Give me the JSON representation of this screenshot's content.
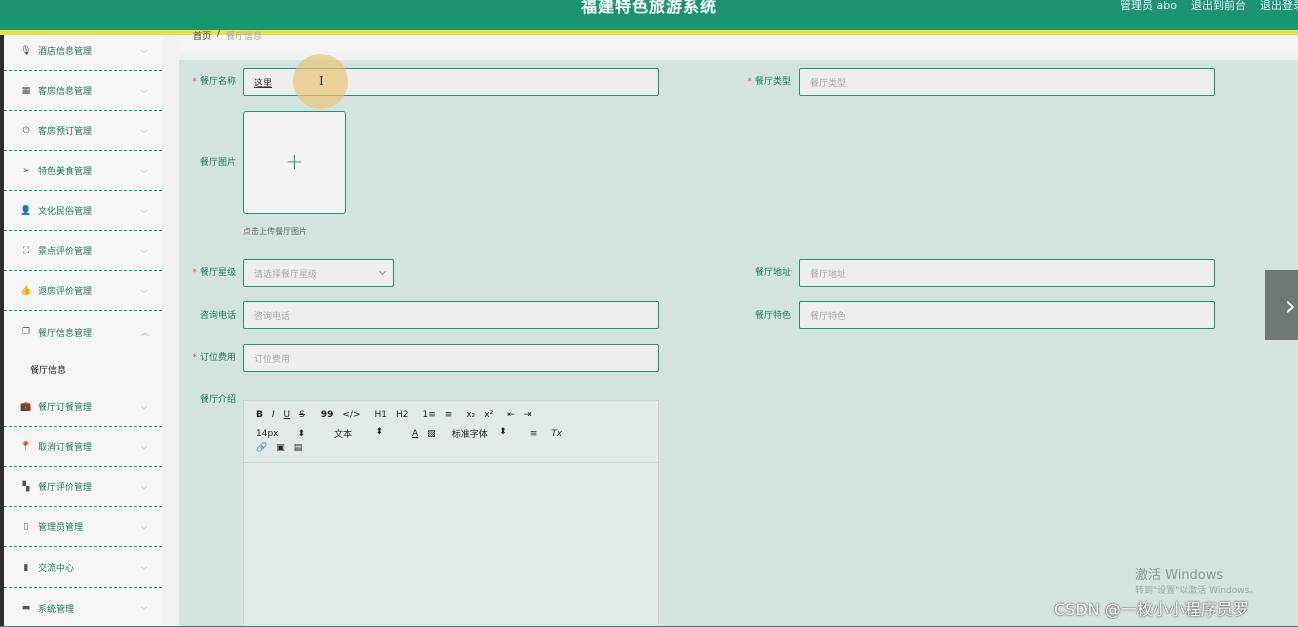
{
  "header": {
    "title": "福建特色旅游系统",
    "links": [
      "管理员 abo",
      "退出到前台",
      "退出登录"
    ]
  },
  "colors": {
    "primary": "#1b9472",
    "stripe": "#e4e24a",
    "content_bg": "#d3e3e0",
    "required": "#e55"
  },
  "breadcrumb": {
    "home": "首页",
    "sep": "/",
    "current": "餐厅信息"
  },
  "sidebar": {
    "items": [
      {
        "label": "酒店信息管理",
        "icon": "mic-icon"
      },
      {
        "label": "客房信息管理",
        "icon": "grid-icon"
      },
      {
        "label": "客房预订管理",
        "icon": "power-icon"
      },
      {
        "label": "特色美食管理",
        "icon": "send-icon"
      },
      {
        "label": "文化民俗管理",
        "icon": "user-icon"
      },
      {
        "label": "景点评价管理",
        "icon": "fullscreen-icon"
      },
      {
        "label": "退房评价管理",
        "icon": "thumbs-up-icon"
      },
      {
        "label": "餐厅信息管理",
        "icon": "copy-icon"
      },
      {
        "label": "餐厅订餐管理",
        "icon": "briefcase-icon"
      },
      {
        "label": "取消订餐管理",
        "icon": "location-icon"
      },
      {
        "label": "餐厅评价管理",
        "icon": "apps-icon"
      },
      {
        "label": "管理员管理",
        "icon": "phone-icon"
      },
      {
        "label": "交流中心",
        "icon": "chart-icon"
      },
      {
        "label": "系统管理",
        "icon": "ticket-icon"
      }
    ],
    "sub_item": "餐厅信息"
  },
  "form": {
    "name": {
      "label": "餐厅名称",
      "value": "这里"
    },
    "type": {
      "label": "餐厅类型",
      "placeholder": "餐厅类型"
    },
    "image": {
      "label": "餐厅图片",
      "plus": "+",
      "hint": "点击上传餐厅图片"
    },
    "rating": {
      "label": "餐厅星级",
      "placeholder": "请选择餐厅星级"
    },
    "address": {
      "label": "餐厅地址",
      "placeholder": "餐厅地址"
    },
    "phone": {
      "label": "咨询电话",
      "placeholder": "咨询电话"
    },
    "feature": {
      "label": "餐厅特色",
      "placeholder": "餐厅特色"
    },
    "fee": {
      "label": "订位费用",
      "placeholder": "订位费用"
    },
    "intro": {
      "label": "餐厅介绍"
    }
  },
  "editor": {
    "row1": [
      "B",
      "I",
      "U",
      "S",
      "99",
      "</>",
      "H1",
      "H2",
      "1≡",
      "≡",
      "x₂",
      "x²",
      "⇤",
      "⇥"
    ],
    "size": "14px",
    "block": "文本",
    "font": "标准字体",
    "row2_tools": [
      "A",
      "▨",
      "≡",
      "Tx"
    ],
    "row3": [
      "🔗",
      "▣",
      "▤"
    ]
  },
  "watermark": {
    "line1": "激活 Windows",
    "line2": "转到\"设置\"以激活 Windows。",
    "csdn": "CSDN @一枚小小程序员罗"
  }
}
